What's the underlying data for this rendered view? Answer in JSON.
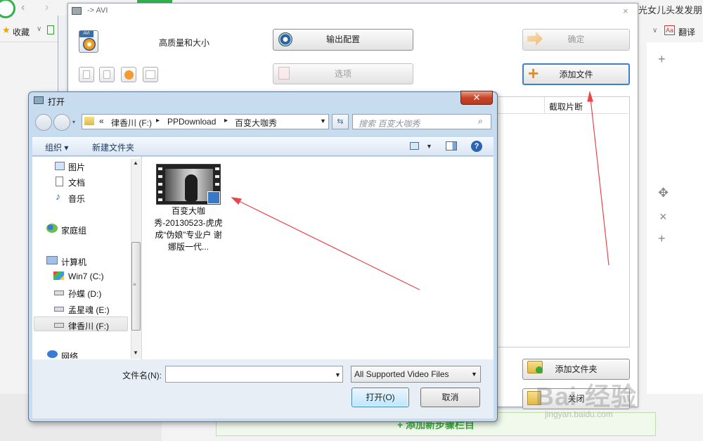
{
  "browser": {
    "favorites_label": "收藏",
    "tab_title_right": "光女儿头发发朋",
    "translate_label": "翻译",
    "translate_icon_text": "Aa"
  },
  "avi_window": {
    "title": "-> AVI",
    "logo_tag": "AVI",
    "quality_label": "高质量和大小",
    "output_config_label": "输出配置",
    "ok_label": "确定",
    "options_label": "选项",
    "add_file_label": "添加文件",
    "clip_column_label": "截取片断",
    "add_folder_label": "添加文件夹",
    "close_label": "关闭",
    "add_step_label": "+ 添加新步骤栏目"
  },
  "open_dialog": {
    "title": "打开",
    "address": {
      "chevron": "«",
      "segments": [
        "律香川 (F:)",
        "PPDownload",
        "百变大咖秀"
      ]
    },
    "search_placeholder": "搜索 百变大咖秀",
    "toolbar": {
      "organize_label": "组织 ▾",
      "new_folder_label": "新建文件夹"
    },
    "nav_items": [
      {
        "label": "图片",
        "icon": "pictures-icon"
      },
      {
        "label": "文档",
        "icon": "documents-icon"
      },
      {
        "label": "音乐",
        "icon": "music-icon"
      },
      {
        "label": "家庭组",
        "icon": "homegroup-icon"
      },
      {
        "label": "计算机",
        "icon": "computer-icon"
      },
      {
        "label": "Win7 (C:)",
        "icon": "drive-icon"
      },
      {
        "label": "孙蝶 (D:)",
        "icon": "drive-icon"
      },
      {
        "label": "孟星魂 (E:)",
        "icon": "drive-icon"
      },
      {
        "label": "律香川 (F:)",
        "icon": "drive-icon"
      },
      {
        "label": "网络",
        "icon": "network-icon"
      }
    ],
    "file": {
      "name": "百变大咖秀-20130523-虎虎成“伪娘”专业户 谢娜版一代..."
    },
    "filename_label": "文件名(N):",
    "filename_value": "",
    "filter_label": "All Supported Video Files",
    "open_button": "打开(O)",
    "cancel_button": "取消"
  },
  "watermark": {
    "text": "Bai 经验",
    "url": "jingyan.baidu.com"
  },
  "colors": {
    "annotation_arrow": "#e8474a",
    "accent_green": "#2fb34a",
    "dialog_frame": "#c8dcef"
  }
}
